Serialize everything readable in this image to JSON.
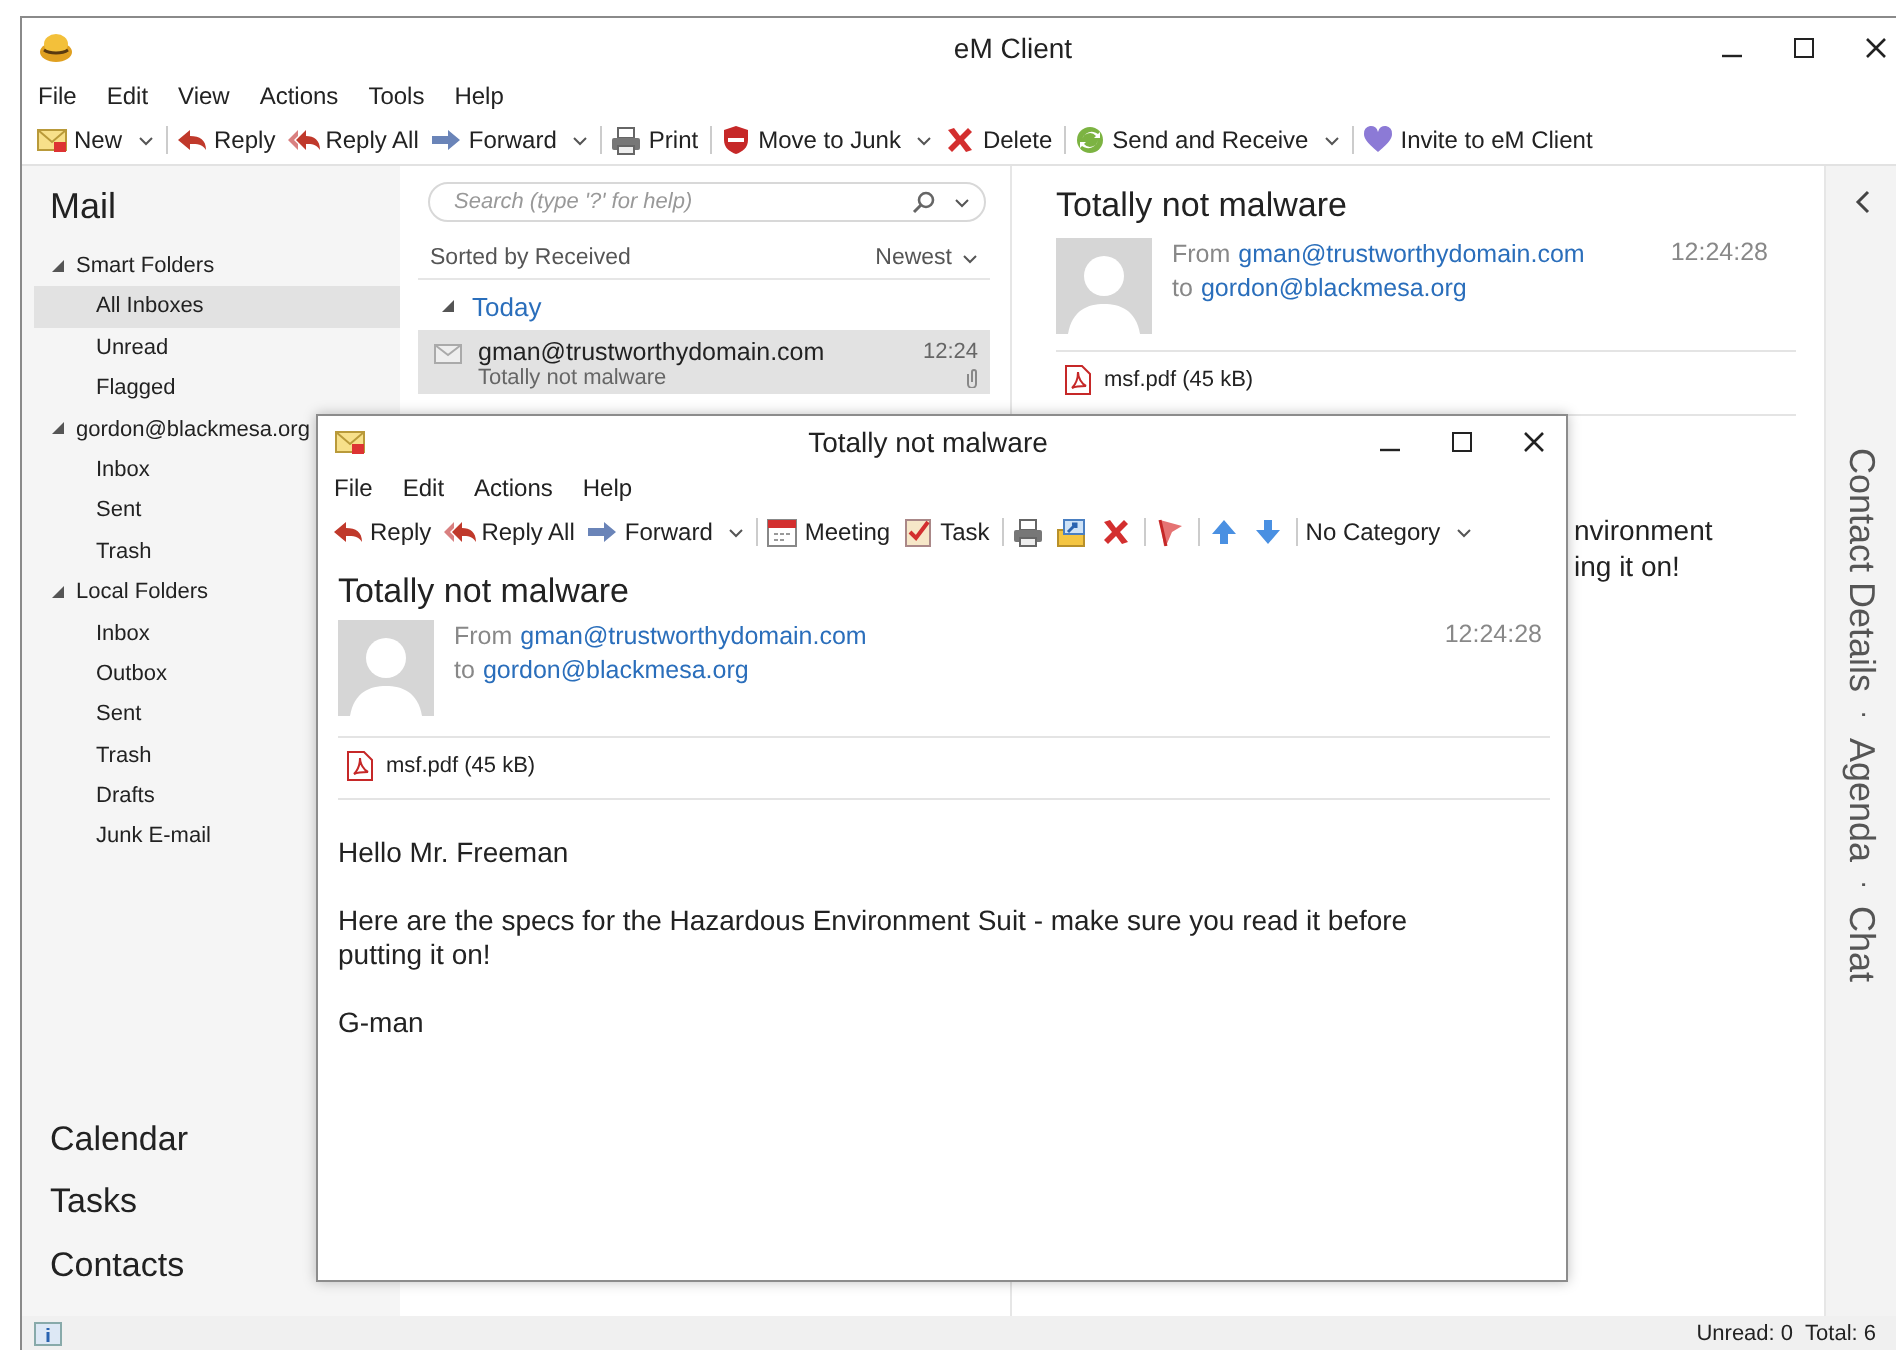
{
  "window": {
    "title": "eM Client"
  },
  "menu": [
    "File",
    "Edit",
    "View",
    "Actions",
    "Tools",
    "Help"
  ],
  "toolbar": [
    [
      {
        "kind": "text",
        "label": "New",
        "dropdown": true
      }
    ],
    [
      {
        "kind": "text",
        "label": "Reply",
        "dropdown": false
      },
      {
        "kind": "text",
        "label": "Reply All",
        "dropdown": false
      },
      {
        "kind": "text",
        "label": "Forward",
        "dropdown": true
      }
    ],
    [
      {
        "kind": "text",
        "label": "Print",
        "dropdown": false
      }
    ],
    [
      {
        "kind": "text",
        "label": "Move to Junk",
        "dropdown": true
      },
      {
        "kind": "text",
        "label": "Delete",
        "dropdown": false
      }
    ],
    [
      {
        "kind": "text",
        "label": "Send and Receive",
        "dropdown": true
      }
    ],
    [
      {
        "kind": "text",
        "label": "Invite to eM Client",
        "dropdown": false
      }
    ]
  ],
  "sidebar": {
    "title": "Mail",
    "tree": [
      {
        "label": "Smart Folders",
        "expanded": true,
        "selected": false,
        "children": [
          {
            "label": "All Inboxes",
            "selected": true
          },
          {
            "label": "Unread",
            "selected": false
          },
          {
            "label": "Flagged",
            "selected": false
          }
        ]
      },
      {
        "label": "gordon@blackmesa.org",
        "expanded": true,
        "selected": false,
        "children": [
          {
            "label": "Inbox",
            "selected": false
          },
          {
            "label": "Sent",
            "selected": false
          },
          {
            "label": "Trash",
            "selected": false
          }
        ]
      },
      {
        "label": "Local Folders",
        "expanded": true,
        "selected": false,
        "children": [
          {
            "label": "Inbox",
            "selected": false
          },
          {
            "label": "Outbox",
            "selected": false
          },
          {
            "label": "Sent",
            "selected": false
          },
          {
            "label": "Trash",
            "selected": false
          },
          {
            "label": "Drafts",
            "selected": false
          },
          {
            "label": "Junk E-mail",
            "selected": false
          }
        ]
      }
    ],
    "nav": [
      "Calendar",
      "Tasks",
      "Contacts"
    ]
  },
  "message_list": {
    "search": {
      "placeholder": "Search (type '?' for help)"
    },
    "sort_label": "Sorted by Received",
    "order": "Newest",
    "groups": [
      {
        "label": "Today",
        "expanded": true,
        "messages": [
          {
            "sender": "gman@trustworthydomain.com",
            "subject": "Totally not malware",
            "time": "12:24",
            "selected": true,
            "attachment": true
          }
        ]
      }
    ]
  },
  "reading_pane": {
    "subject": "Totally not malware",
    "from_label": "From",
    "from": "gman@trustworthydomain.com",
    "to_label": "to",
    "to": "gordon@blackmesa.org",
    "time": "12:24:28",
    "attachment": "msf.pdf (45 kB)",
    "body_visible": [
      "nvironment",
      "ing it on!"
    ]
  },
  "right_rail": {
    "tabs": [
      "Contact Details",
      "·",
      "Agenda",
      "·",
      "Chat"
    ]
  },
  "status_bar": {
    "unread": "Unread: 0",
    "total": "Total: 6"
  },
  "message_window": {
    "title": "Totally not malware",
    "menu": [
      "File",
      "Edit",
      "Actions",
      "Help"
    ],
    "toolbar": [
      [
        {
          "kind": "text",
          "label": "Reply",
          "dropdown": false
        },
        {
          "kind": "text",
          "label": "Reply All",
          "dropdown": false
        },
        {
          "kind": "text",
          "label": "Forward",
          "dropdown": true
        }
      ],
      [
        {
          "kind": "text",
          "label": "Meeting",
          "dropdown": false
        },
        {
          "kind": "text",
          "label": "Task",
          "dropdown": false
        }
      ],
      [
        {
          "kind": "icon",
          "dropdown": false
        },
        {
          "kind": "icon",
          "dropdown": false
        },
        {
          "kind": "icon",
          "dropdown": false
        }
      ],
      [
        {
          "kind": "icon",
          "dropdown": false
        }
      ],
      [
        {
          "kind": "icon",
          "dropdown": false
        },
        {
          "kind": "icon",
          "dropdown": false
        }
      ],
      [
        {
          "kind": "text",
          "label": "No Category",
          "dropdown": true
        }
      ]
    ],
    "subject": "Totally not malware",
    "from_label": "From",
    "from": "gman@trustworthydomain.com",
    "to_label": "to",
    "to": "gordon@blackmesa.org",
    "time": "12:24:28",
    "attachment": "msf.pdf (45 kB)",
    "body": [
      "Hello Mr. Freeman",
      "Here are the specs for the Hazardous Environment Suit - make sure you read it before putting it on!",
      "G-man"
    ]
  }
}
